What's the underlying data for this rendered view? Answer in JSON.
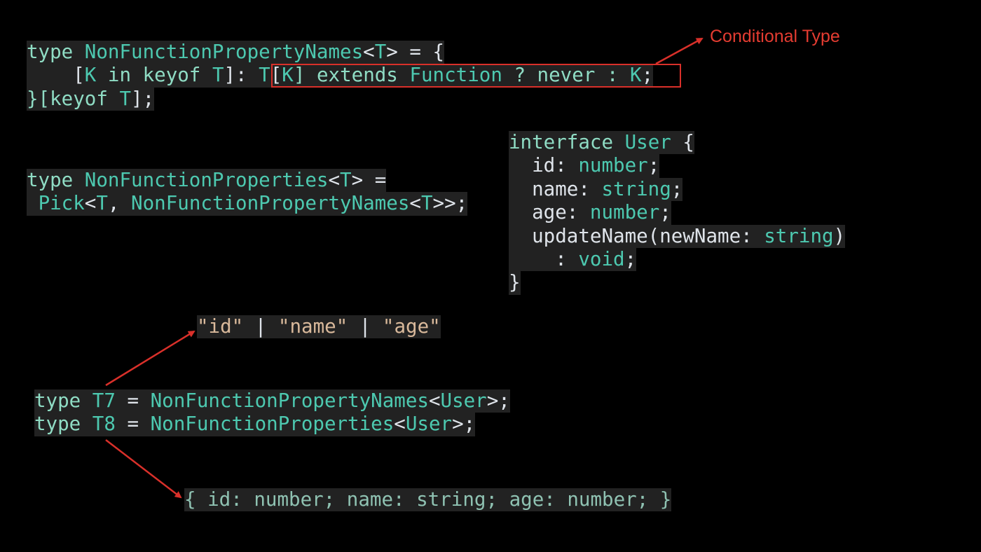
{
  "annotation": {
    "label": "Conditional Type",
    "color": "#e43c31"
  },
  "colors": {
    "background": "#000000",
    "code_bg": "#222222",
    "type": "#4dc9b0",
    "keyword": "#8fdcc4",
    "string": "#d9b99b"
  },
  "code_top": {
    "l1": {
      "a": "type ",
      "b": "NonFunctionPropertyNames",
      "c": "<",
      "d": "T",
      "e": "> = {"
    },
    "l2": {
      "a": "    [",
      "b": "K",
      "c": " in keyof ",
      "d": "T",
      "e": "]: ",
      "f": "T",
      "g": "[",
      "h": "K",
      "i": "] extends ",
      "j": "Function",
      "k": " ? never : ",
      "l": "K",
      "m": ";"
    },
    "l3": {
      "a": "}[keyof ",
      "b": "T",
      "c": "];"
    }
  },
  "code_props": {
    "l1": {
      "a": "type ",
      "b": "NonFunctionProperties",
      "c": "<",
      "d": "T",
      "e": "> ="
    },
    "l2": {
      "a": " ",
      "b": "Pick",
      "c": "<",
      "d": "T",
      "e": ", ",
      "f": "NonFunctionPropertyNames",
      "g": "<",
      "h": "T",
      "i": ">>;"
    }
  },
  "code_interface": {
    "l1": {
      "a": "interface ",
      "b": "User",
      "c": " {"
    },
    "l2": {
      "a": "  id: ",
      "b": "number",
      "c": ";"
    },
    "l3": {
      "a": "  name: ",
      "b": "string",
      "c": ";"
    },
    "l4": {
      "a": "  age: ",
      "b": "number",
      "c": ";"
    },
    "l5": {
      "a": "  updateName(newName: ",
      "b": "string",
      "c": ")"
    },
    "l6": {
      "a": "    : ",
      "b": "void",
      "c": ";"
    },
    "l7": {
      "a": "}"
    }
  },
  "result_names": {
    "a": "\"id\"",
    "b": " | ",
    "c": "\"name\"",
    "d": " | ",
    "e": "\"age\""
  },
  "code_aliases": {
    "l1": {
      "a": "type ",
      "b": "T7",
      "c": " = ",
      "d": "NonFunctionPropertyNames",
      "e": "<",
      "f": "User",
      "g": ">;"
    },
    "l2": {
      "a": "type ",
      "b": "T8",
      "c": " = ",
      "d": "NonFunctionProperties",
      "e": "<",
      "f": "User",
      "g": ">;"
    }
  },
  "result_object": "{ id: number; name: string; age: number; }"
}
